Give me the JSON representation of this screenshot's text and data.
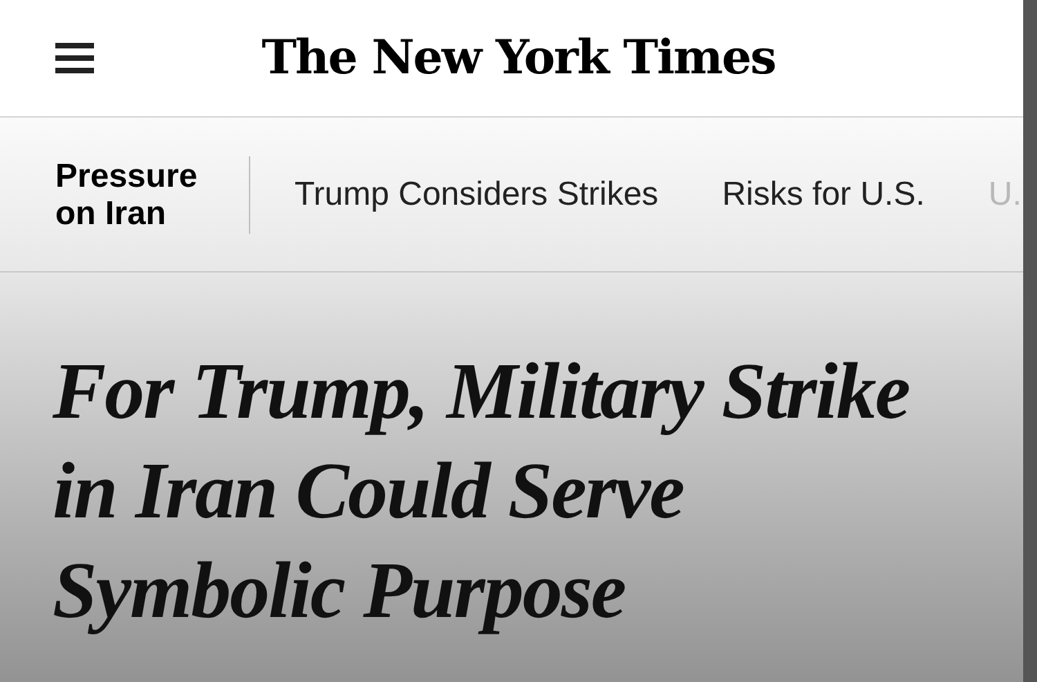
{
  "header": {
    "logo": "The New York Times"
  },
  "topic_bar": {
    "topic": "Pressure on Iran",
    "items": [
      {
        "label": "Trump Considers Strikes",
        "faded": false
      },
      {
        "label": "Risks for U.S.",
        "faded": false
      },
      {
        "label": "U.",
        "faded": true
      }
    ]
  },
  "article": {
    "headline": "For Trump, Military Strike in Iran Could Serve Symbolic Purpose"
  }
}
